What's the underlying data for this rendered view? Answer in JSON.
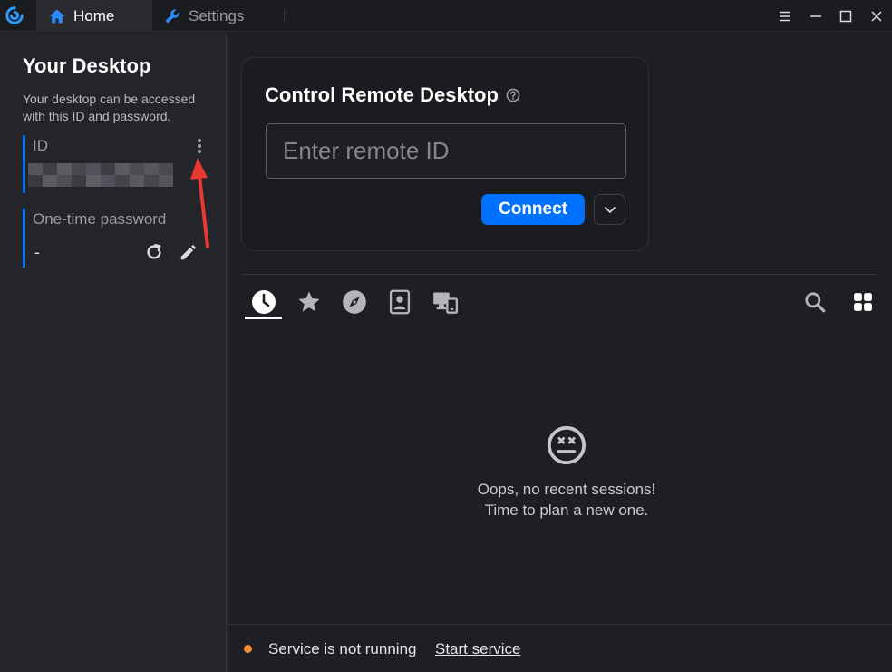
{
  "titlebar": {
    "tabs": [
      {
        "label": "Home",
        "icon": "home-icon",
        "active": true
      },
      {
        "label": "Settings",
        "icon": "wrench-icon",
        "active": false
      }
    ],
    "window_controls": [
      "menu-icon",
      "minimize-icon",
      "maximize-icon",
      "close-icon"
    ]
  },
  "sidebar": {
    "title": "Your Desktop",
    "description": "Your desktop can be accessed with this ID and password.",
    "id_label": "ID",
    "otp_label": "One-time password",
    "otp_value": "-"
  },
  "control": {
    "title": "Control Remote Desktop",
    "input_placeholder": "Enter remote ID",
    "input_value": "",
    "connect_label": "Connect"
  },
  "session_tabs": [
    "recent-sessions-icon",
    "favorites-icon",
    "discovered-icon",
    "address-book-icon",
    "lan-devices-icon"
  ],
  "empty_state": {
    "line1": "Oops, no recent sessions!",
    "line2": "Time to plan a new one."
  },
  "status": {
    "text": "Service is not running",
    "link": "Start service"
  },
  "colors": {
    "accent": "#0071ff",
    "status_warning": "#f58a33",
    "annotation_arrow": "#e8382f"
  }
}
